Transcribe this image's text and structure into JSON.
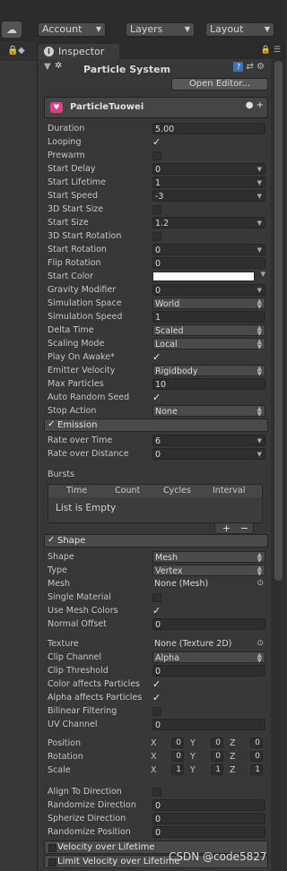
{
  "toolbar": {
    "cloud_icon": "cloud-icon",
    "account": "Account",
    "layers": "Layers",
    "layout": "Layout"
  },
  "tab": {
    "label": "Inspector"
  },
  "component": {
    "title": "Particle System",
    "open_editor": "Open Editor..."
  },
  "main_module": {
    "title": "ParticleTuowei"
  },
  "main_props": [
    {
      "label": "Duration",
      "value": "5.00",
      "kind": "box"
    },
    {
      "label": "Looping",
      "value": "✓",
      "kind": "check"
    },
    {
      "label": "Prewarm",
      "value": "",
      "kind": "uncheck"
    },
    {
      "label": "Start Delay",
      "value": "0",
      "kind": "box-arrow"
    },
    {
      "label": "Start Lifetime",
      "value": "1",
      "kind": "box-arrow"
    },
    {
      "label": "Start Speed",
      "value": "-3",
      "kind": "box-arrow"
    },
    {
      "label": "3D Start Size",
      "value": "",
      "kind": "uncheck"
    },
    {
      "label": "Start Size",
      "value": "1.2",
      "kind": "box-arrow"
    },
    {
      "label": "3D Start Rotation",
      "value": "",
      "kind": "uncheck"
    },
    {
      "label": "Start Rotation",
      "value": "0",
      "kind": "box-arrow"
    },
    {
      "label": "Flip Rotation",
      "value": "0",
      "kind": "box"
    },
    {
      "label": "Start Color",
      "value": "",
      "kind": "color"
    },
    {
      "label": "Gravity Modifier",
      "value": "0",
      "kind": "box-arrow"
    },
    {
      "label": "Simulation Space",
      "value": "World",
      "kind": "drop"
    },
    {
      "label": "Simulation Speed",
      "value": "1",
      "kind": "box"
    },
    {
      "label": "Delta Time",
      "value": "Scaled",
      "kind": "drop"
    },
    {
      "label": "Scaling Mode",
      "value": "Local",
      "kind": "drop"
    },
    {
      "label": "Play On Awake*",
      "value": "✓",
      "kind": "check"
    },
    {
      "label": "Emitter Velocity",
      "value": "Rigidbody",
      "kind": "drop"
    },
    {
      "label": "Max Particles",
      "value": "10",
      "kind": "box"
    },
    {
      "label": "Auto Random Seed",
      "value": "✓",
      "kind": "check"
    },
    {
      "label": "Stop Action",
      "value": "None",
      "kind": "drop"
    }
  ],
  "emission": {
    "title": "Emission",
    "rate_time_label": "Rate over Time",
    "rate_time_value": "6",
    "rate_dist_label": "Rate over Distance",
    "rate_dist_value": "0",
    "bursts_label": "Bursts",
    "bursts_cols": [
      "Time",
      "Count",
      "Cycles",
      "Interval"
    ],
    "bursts_empty": "List is Empty",
    "add": "+",
    "remove": "−"
  },
  "shape": {
    "title": "Shape",
    "props": [
      {
        "label": "Shape",
        "value": "Mesh",
        "kind": "drop"
      },
      {
        "label": "Type",
        "value": "Vertex",
        "kind": "drop"
      },
      {
        "label": "Mesh",
        "value": "None (Mesh)",
        "kind": "obj"
      },
      {
        "label": "Single Material",
        "value": "",
        "kind": "uncheck"
      },
      {
        "label": "Use Mesh Colors",
        "value": "✓",
        "kind": "check"
      },
      {
        "label": "Normal Offset",
        "value": "0",
        "kind": "box"
      }
    ],
    "props2": [
      {
        "label": "Texture",
        "value": "None (Texture 2D)",
        "kind": "obj"
      },
      {
        "label": "Clip Channel",
        "value": "Alpha",
        "kind": "drop"
      },
      {
        "label": "Clip Threshold",
        "value": "0",
        "kind": "box"
      },
      {
        "label": "Color affects Particles",
        "value": "✓",
        "kind": "check"
      },
      {
        "label": "Alpha affects Particles",
        "value": "✓",
        "kind": "check"
      },
      {
        "label": "Bilinear Filtering",
        "value": "",
        "kind": "uncheck"
      },
      {
        "label": "UV Channel",
        "value": "0",
        "kind": "box"
      }
    ],
    "position_label": "Position",
    "rotation_label": "Rotation",
    "scale_label": "Scale",
    "position": [
      "0",
      "0",
      "0"
    ],
    "rotation": [
      "0",
      "0",
      "0"
    ],
    "scale": [
      "1",
      "1",
      "1"
    ],
    "axis": [
      "X",
      "Y",
      "Z"
    ],
    "props3": [
      {
        "label": "Align To Direction",
        "value": "",
        "kind": "uncheck"
      },
      {
        "label": "Randomize Direction",
        "value": "0",
        "kind": "box"
      },
      {
        "label": "Spherize Direction",
        "value": "0",
        "kind": "box"
      },
      {
        "label": "Randomize Position",
        "value": "0",
        "kind": "box"
      }
    ]
  },
  "modules": {
    "velocity": "Velocity over Lifetime",
    "limit_velocity": "Limit Velocity over Lifetime"
  },
  "watermark": "CSDN @code5827"
}
